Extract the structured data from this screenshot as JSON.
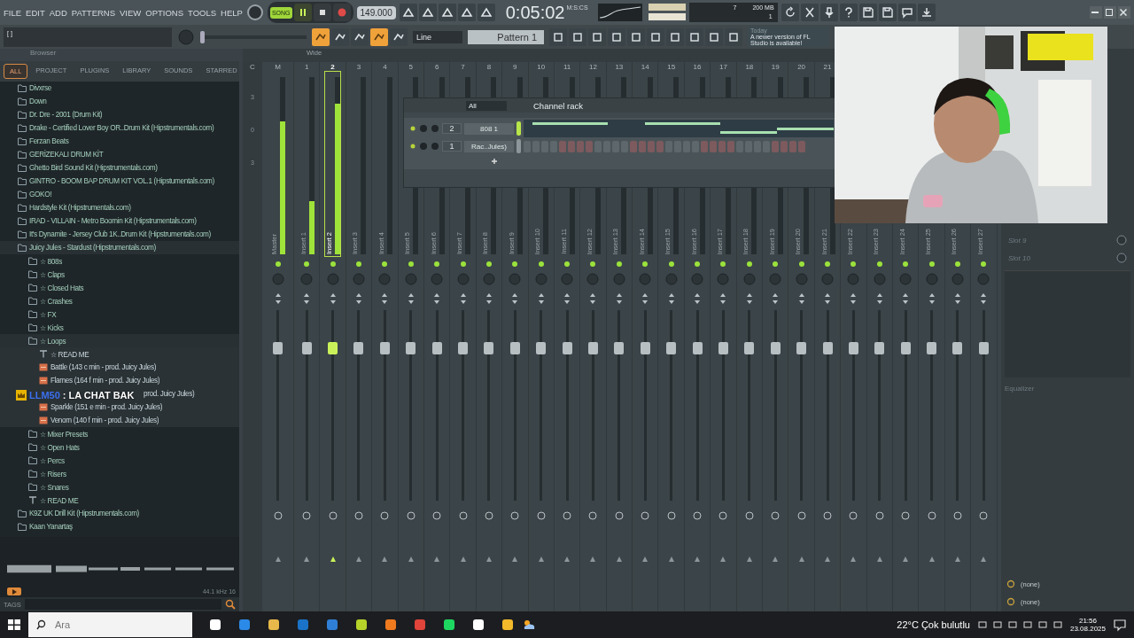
{
  "menu": [
    "FILE",
    "EDIT",
    "ADD",
    "PATTERNS",
    "VIEW",
    "OPTIONS",
    "TOOLS",
    "HELP"
  ],
  "transport": {
    "mode": "SONG",
    "song_mode": true,
    "playing": true,
    "tempo": "149.000"
  },
  "time": {
    "value": "0:05:02",
    "unit": "M:S:CS"
  },
  "performance": {
    "voices": "7",
    "memory": "200 MB",
    "polyphony": "1"
  },
  "hint_bar": {
    "text": "[ ]"
  },
  "toolbar": {
    "snap": "Line",
    "pattern": "Pattern 1",
    "master_pitch": {
      "level": 0
    }
  },
  "news": {
    "date": "Today",
    "message": "A newer version of FL Studio is available!"
  },
  "browser": {
    "title": "Browser",
    "tabs": [
      {
        "label": "ALL",
        "selected": true
      },
      {
        "label": "PROJECT",
        "selected": false
      },
      {
        "label": "PLUGINS",
        "selected": false
      },
      {
        "label": "LIBRARY",
        "selected": false
      },
      {
        "label": "SOUNDS",
        "selected": false
      },
      {
        "label": "STARRED",
        "selected": false
      }
    ],
    "tree": [
      {
        "label": "Divxrse",
        "kind": "folder"
      },
      {
        "label": "Down",
        "kind": "folder"
      },
      {
        "label": "Dr. Dre - 2001 (Drum Kit)",
        "kind": "folder"
      },
      {
        "label": "Drake - Certified Lover Boy OR..Drum Kit (Hipstrumentals.com)",
        "kind": "folder"
      },
      {
        "label": "Ferzan Beats",
        "kind": "folder"
      },
      {
        "label": "GERİZEKALI DRUM KİT",
        "kind": "folder"
      },
      {
        "label": "Ghetto Bird Sound Kit (Hipstrumentals.com)",
        "kind": "folder"
      },
      {
        "label": "GINTRO - BOOM BAP DRUM KIT VOL.1 (Hipstumentals.com)",
        "kind": "folder"
      },
      {
        "label": "GOKO!",
        "kind": "folder"
      },
      {
        "label": "Hardstyle Kit (Hipstrumentals.com)",
        "kind": "folder"
      },
      {
        "label": "IRAD - VILLAIN - Metro Boomin Kit (Hipstrumentals.com)",
        "kind": "folder"
      },
      {
        "label": "It's Dynamite - Jersey Club 1K..Drum Kit (Hipstrumentals.com)",
        "kind": "folder"
      },
      {
        "label": "Juicy Jules - Stardust (Hipstrumentals.com)",
        "kind": "folder",
        "children": [
          {
            "label": "☆ 808s",
            "kind": "folder"
          },
          {
            "label": "☆ Claps",
            "kind": "folder"
          },
          {
            "label": "☆ Closed Hats",
            "kind": "folder"
          },
          {
            "label": "☆ Crashes",
            "kind": "folder"
          },
          {
            "label": "☆ FX",
            "kind": "folder"
          },
          {
            "label": "☆ Kicks",
            "kind": "folder"
          },
          {
            "label": "☆ Loops",
            "kind": "folder",
            "children": [
              {
                "label": "☆ READ ME",
                "kind": "text"
              },
              {
                "label": "Battle (143 c min - prod. Juicy Jules)",
                "kind": "audio"
              },
              {
                "label": "Flames (164 f min - prod. Juicy Jules)",
                "kind": "audio"
              },
              {
                "label": "prod. Juicy Jules)",
                "kind": "covered"
              },
              {
                "label": "Sparkle (151 e min - prod. Juicy Jules)",
                "kind": "audio"
              },
              {
                "label": "Venom (140 f min - prod. Juicy Jules)",
                "kind": "audio"
              }
            ]
          },
          {
            "label": "☆ Mixer Presets",
            "kind": "folder"
          },
          {
            "label": "☆ Open Hats",
            "kind": "folder"
          },
          {
            "label": "☆ Percs",
            "kind": "folder"
          },
          {
            "label": "☆ Risers",
            "kind": "folder"
          },
          {
            "label": "☆ Snares",
            "kind": "folder"
          },
          {
            "label": "☆ READ ME",
            "kind": "text"
          }
        ]
      },
      {
        "label": "K9Z UK Drill Kit (Hipstrumentals.com)",
        "kind": "folder"
      },
      {
        "label": "Kaan Yanartaş",
        "kind": "folder"
      }
    ],
    "sample_info": "44.1 kHz 16",
    "tags_label": "TAGS"
  },
  "chat_overlay": {
    "user": "LLM50",
    "message": ": LA CHAT BAK"
  },
  "mixer": {
    "view": "Wide",
    "current_label": "C",
    "scale": [
      "3",
      "0",
      "3"
    ],
    "strips": [
      {
        "number": "M",
        "label": "Master",
        "level": 0.75,
        "selected": false
      },
      {
        "number": "1",
        "label": "Insert 1",
        "level": 0.3,
        "selected": false
      },
      {
        "number": "2",
        "label": "Insert 2",
        "level": 0.85,
        "selected": true
      },
      {
        "number": "3",
        "label": "Insert 3",
        "level": 0,
        "selected": false
      },
      {
        "number": "4",
        "label": "Insert 4",
        "level": 0,
        "selected": false
      },
      {
        "number": "5",
        "label": "Insert 5",
        "level": 0,
        "selected": false
      },
      {
        "number": "6",
        "label": "Insert 6",
        "level": 0,
        "selected": false
      },
      {
        "number": "7",
        "label": "Insert 7",
        "level": 0,
        "selected": false
      },
      {
        "number": "8",
        "label": "Insert 8",
        "level": 0,
        "selected": false
      },
      {
        "number": "9",
        "label": "Insert 9",
        "level": 0,
        "selected": false
      },
      {
        "number": "10",
        "label": "Insert 10",
        "level": 0,
        "selected": false
      },
      {
        "number": "11",
        "label": "Insert 11",
        "level": 0,
        "selected": false
      },
      {
        "number": "12",
        "label": "Insert 12",
        "level": 0,
        "selected": false
      },
      {
        "number": "13",
        "label": "Insert 13",
        "level": 0,
        "selected": false
      },
      {
        "number": "14",
        "label": "Insert 14",
        "level": 0,
        "selected": false
      },
      {
        "number": "15",
        "label": "Insert 15",
        "level": 0,
        "selected": false
      },
      {
        "number": "16",
        "label": "Insert 16",
        "level": 0,
        "selected": false
      },
      {
        "number": "17",
        "label": "Insert 17",
        "level": 0,
        "selected": false
      },
      {
        "number": "18",
        "label": "Insert 18",
        "level": 0,
        "selected": false
      },
      {
        "number": "19",
        "label": "Insert 19",
        "level": 0,
        "selected": false
      },
      {
        "number": "20",
        "label": "Insert 20",
        "level": 0,
        "selected": false
      },
      {
        "number": "21",
        "label": "Insert 21",
        "level": 0,
        "selected": false
      },
      {
        "label": "Insert 22",
        "selected": false
      },
      {
        "label": "Insert 23",
        "selected": false
      },
      {
        "label": "Insert 24",
        "selected": false
      },
      {
        "label": "Insert 25",
        "selected": false
      },
      {
        "label": "Insert 26",
        "selected": false
      },
      {
        "label": "Insert 27",
        "selected": false
      }
    ]
  },
  "channel_rack": {
    "title": "Channel rack",
    "filter": "All",
    "channels": [
      {
        "number": "2",
        "name": "808 1",
        "kind": "notes",
        "selected": true
      },
      {
        "number": "1",
        "name": "Rac..Jules)",
        "kind": "steps",
        "selected": false
      }
    ]
  },
  "effects": {
    "slots": [
      "Slot 9",
      "Slot 10"
    ],
    "equalizer": "Equalizer",
    "routes": [
      "(none)",
      "(none)"
    ]
  },
  "taskbar": {
    "search_placeholder": "Ara",
    "weather": "22°C Çok bulutlu",
    "time": "21:56",
    "date": "23.08.2025"
  }
}
